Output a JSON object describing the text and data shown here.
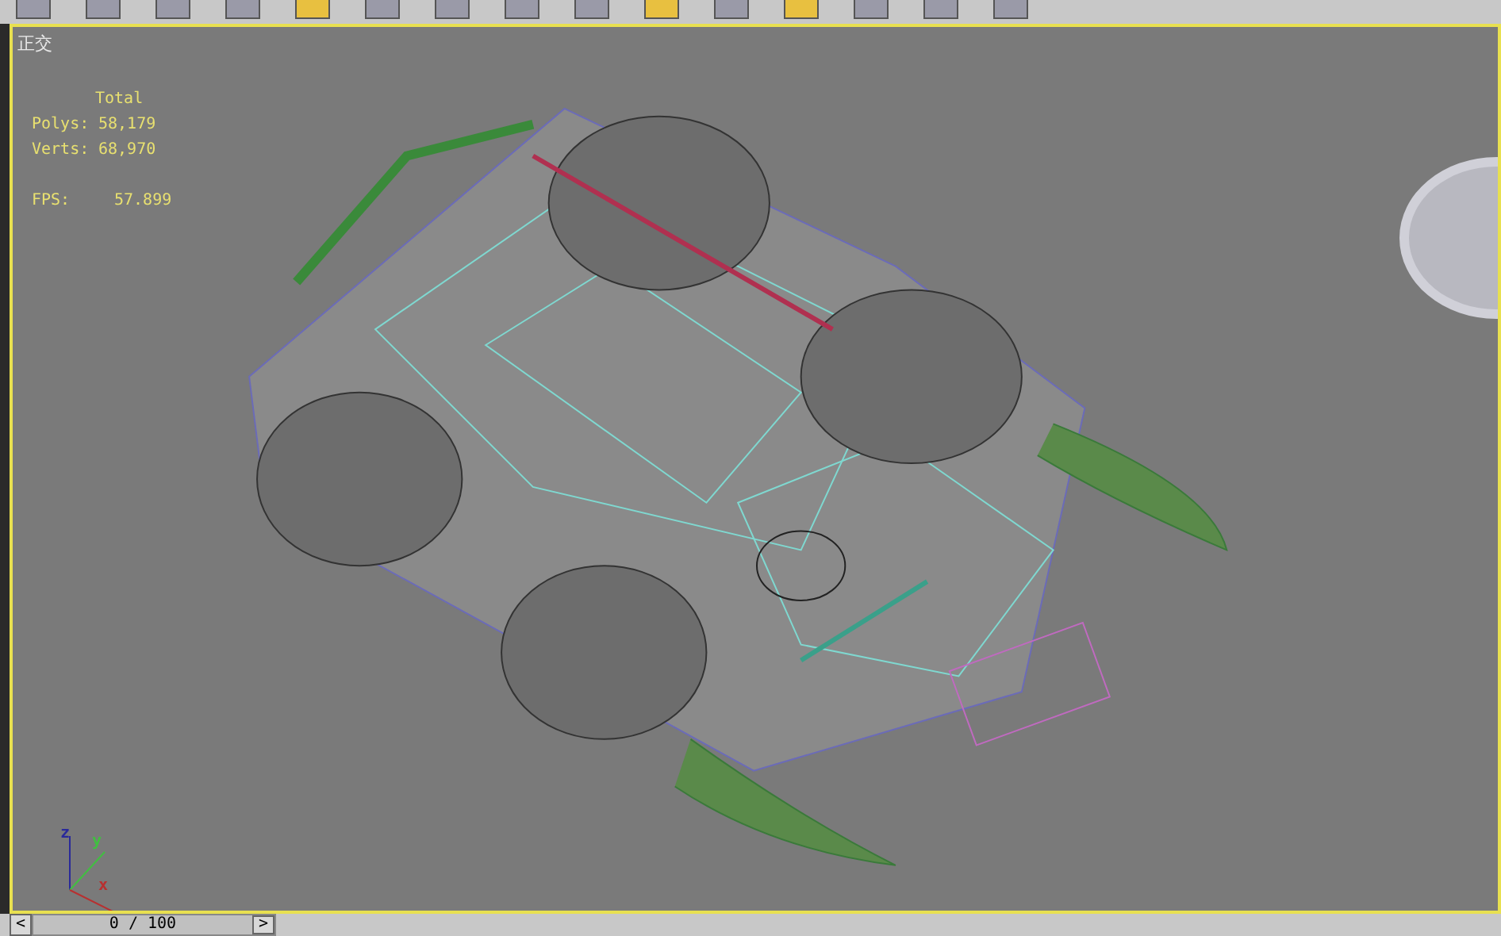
{
  "viewport": {
    "label": "正交",
    "stats": {
      "header": "Total",
      "rows": [
        {
          "label": "Polys:",
          "value": "58,179"
        },
        {
          "label": "Verts:",
          "value": "68,970"
        }
      ],
      "fps_label": "FPS:",
      "fps_value": "57.899"
    },
    "axes": [
      {
        "label": "z",
        "color": "#2a2a9a"
      },
      {
        "label": "y",
        "color": "#40c040"
      },
      {
        "label": "x",
        "color": "#b83030"
      }
    ]
  },
  "timeline": {
    "prev": "<",
    "position": "0 / 100",
    "next": ">"
  }
}
